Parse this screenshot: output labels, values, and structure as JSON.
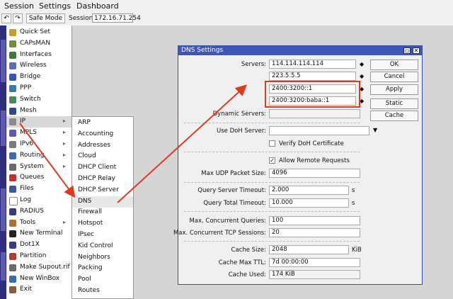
{
  "menubar": [
    "Session",
    "Settings",
    "Dashboard"
  ],
  "toolbar": {
    "undo": "↶",
    "redo": "↷",
    "safe_mode": "Safe Mode",
    "session_label": "Session:",
    "session_value": "172.16.71.254"
  },
  "menu": [
    {
      "label": "Quick Set",
      "icon": "quick-set-icon",
      "color": "#c99a2e"
    },
    {
      "label": "CAPsMAN",
      "icon": "capsman-icon",
      "color": "#6f8f3a"
    },
    {
      "label": "Interfaces",
      "icon": "interfaces-icon",
      "color": "#3c7a3c"
    },
    {
      "label": "Wireless",
      "icon": "wireless-icon",
      "color": "#5b6fb5"
    },
    {
      "label": "Bridge",
      "icon": "bridge-icon",
      "color": "#2f59b8"
    },
    {
      "label": "PPP",
      "icon": "ppp-icon",
      "color": "#3a7ab0"
    },
    {
      "label": "Switch",
      "icon": "switch-icon",
      "color": "#4a8a5a"
    },
    {
      "label": "Mesh",
      "icon": "mesh-icon",
      "color": "#2a4a8a"
    },
    {
      "label": "IP",
      "icon": "ip-icon",
      "color": "#8a8a8a",
      "arrow": "▸"
    },
    {
      "label": "MPLS",
      "icon": "mpls-icon",
      "color": "#5a5ab0",
      "arrow": "▸"
    },
    {
      "label": "IPv6",
      "icon": "ipv6-icon",
      "color": "#7a7a7a",
      "arrow": "▸"
    },
    {
      "label": "Routing",
      "icon": "routing-icon",
      "color": "#3a6ab0",
      "arrow": "▸"
    },
    {
      "label": "System",
      "icon": "system-icon",
      "color": "#6a6a6a",
      "arrow": "▸"
    },
    {
      "label": "Queues",
      "icon": "queues-icon",
      "color": "#c03030"
    },
    {
      "label": "Files",
      "icon": "files-icon",
      "color": "#3a5a9a"
    },
    {
      "label": "Log",
      "icon": "log-icon",
      "color": "#ffffff"
    },
    {
      "label": "RADIUS",
      "icon": "radius-icon",
      "color": "#3a3a7a"
    },
    {
      "label": "Tools",
      "icon": "tools-icon",
      "color": "#b07030",
      "arrow": "▸"
    },
    {
      "label": "New Terminal",
      "icon": "terminal-icon",
      "color": "#222222"
    },
    {
      "label": "Dot1X",
      "icon": "dot1x-icon",
      "color": "#3a3a8a"
    },
    {
      "label": "Partition",
      "icon": "partition-icon",
      "color": "#b03a3a"
    },
    {
      "label": "Make Supout.rif",
      "icon": "supout-icon",
      "color": "#6a6a6a"
    },
    {
      "label": "New WinBox",
      "icon": "winbox-icon",
      "color": "#3a6ab0"
    },
    {
      "label": "Exit",
      "icon": "exit-icon",
      "color": "#8a5a3a"
    }
  ],
  "submenu": [
    "ARP",
    "Accounting",
    "Addresses",
    "Cloud",
    "DHCP Client",
    "DHCP Relay",
    "DHCP Server",
    "DNS",
    "Firewall",
    "Hotspot",
    "IPsec",
    "Kid Control",
    "Neighbors",
    "Packing",
    "Pool",
    "Routes"
  ],
  "dns": {
    "title": "DNS Settings",
    "servers_label": "Servers:",
    "servers": [
      "114.114.114.114",
      "223.5.5.5",
      "2400:3200::1",
      "2400:3200:baba::1"
    ],
    "dynamic_servers_label": "Dynamic Servers:",
    "doh_label": "Use DoH Server:",
    "verify_doh": "Verify DoH Certificate",
    "allow_remote": "Allow Remote Requests",
    "max_udp_label": "Max UDP Packet Size:",
    "max_udp": "4096",
    "qst_label": "Query Server Timeout:",
    "qst": "2.000",
    "qtt_label": "Query Total Timeout:",
    "qtt": "10.000",
    "seconds_unit": "s",
    "mcq_label": "Max. Concurrent Queries:",
    "mcq": "100",
    "mcts_label": "Max. Concurrent TCP Sessions:",
    "mcts": "20",
    "cache_size_label": "Cache Size:",
    "cache_size": "2048",
    "cache_unit": "KiB",
    "cache_ttl_label": "Cache Max TTL:",
    "cache_ttl": "7d 00:00:00",
    "cache_used_label": "Cache Used:",
    "cache_used": "174 KiB",
    "buttons": [
      "OK",
      "Cancel",
      "Apply",
      "Static",
      "Cache"
    ],
    "restore": "▭",
    "close": "✕"
  },
  "colors": {
    "annotation": "#e03a1e",
    "titlebar": "#3d56b8"
  }
}
